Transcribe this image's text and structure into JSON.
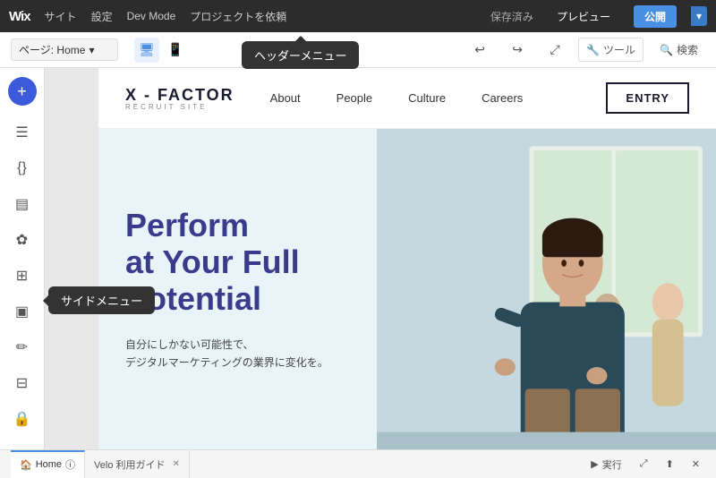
{
  "topbar": {
    "wix_logo": "Wix",
    "menu_items": [
      "サイト",
      "設定",
      "Dev Mode",
      "プロジェクトを依頼"
    ],
    "active_page": "ページ: Home",
    "saved_status": "保存済み",
    "preview_label": "プレビュー",
    "publish_label": "公開",
    "tooltip_header": "ヘッダーメニュー"
  },
  "toolbar": {
    "undo_icon": "↩",
    "redo_icon": "↪",
    "stretch_icon": "⤢",
    "tools_label": "ツール",
    "search_label": "検索"
  },
  "sidebar": {
    "add_icon": "+",
    "items": [
      {
        "name": "pages-icon",
        "icon": "☰"
      },
      {
        "name": "code-icon",
        "icon": "{}"
      },
      {
        "name": "content-icon",
        "icon": "▤"
      },
      {
        "name": "media-icon",
        "icon": "✿"
      },
      {
        "name": "apps-icon",
        "icon": "⊞"
      },
      {
        "name": "image-icon",
        "icon": "▣"
      },
      {
        "name": "draw-icon",
        "icon": "✏"
      },
      {
        "name": "layout-icon",
        "icon": "⊟"
      },
      {
        "name": "lock-icon",
        "icon": "🔒"
      }
    ],
    "tooltip_side": "サイドメニュー"
  },
  "site": {
    "logo_main": "X - FACTOR",
    "logo_sub": "RECRUIT SITE",
    "nav": {
      "items": [
        "About",
        "People",
        "Culture",
        "Careers"
      ]
    },
    "entry_btn": "ENTRY",
    "hero": {
      "title": "Perform\nat Your Full\nPotential",
      "subtitle_line1": "自分にしかない可能性で、",
      "subtitle_line2": "デジタルマーケティングの業界に変化を。"
    }
  },
  "bottombar": {
    "tab_home_label": "Home",
    "tab_velo_label": "Velo 利用ガイド",
    "actions": {
      "run_label": "実行",
      "run_icon": "▶"
    }
  }
}
